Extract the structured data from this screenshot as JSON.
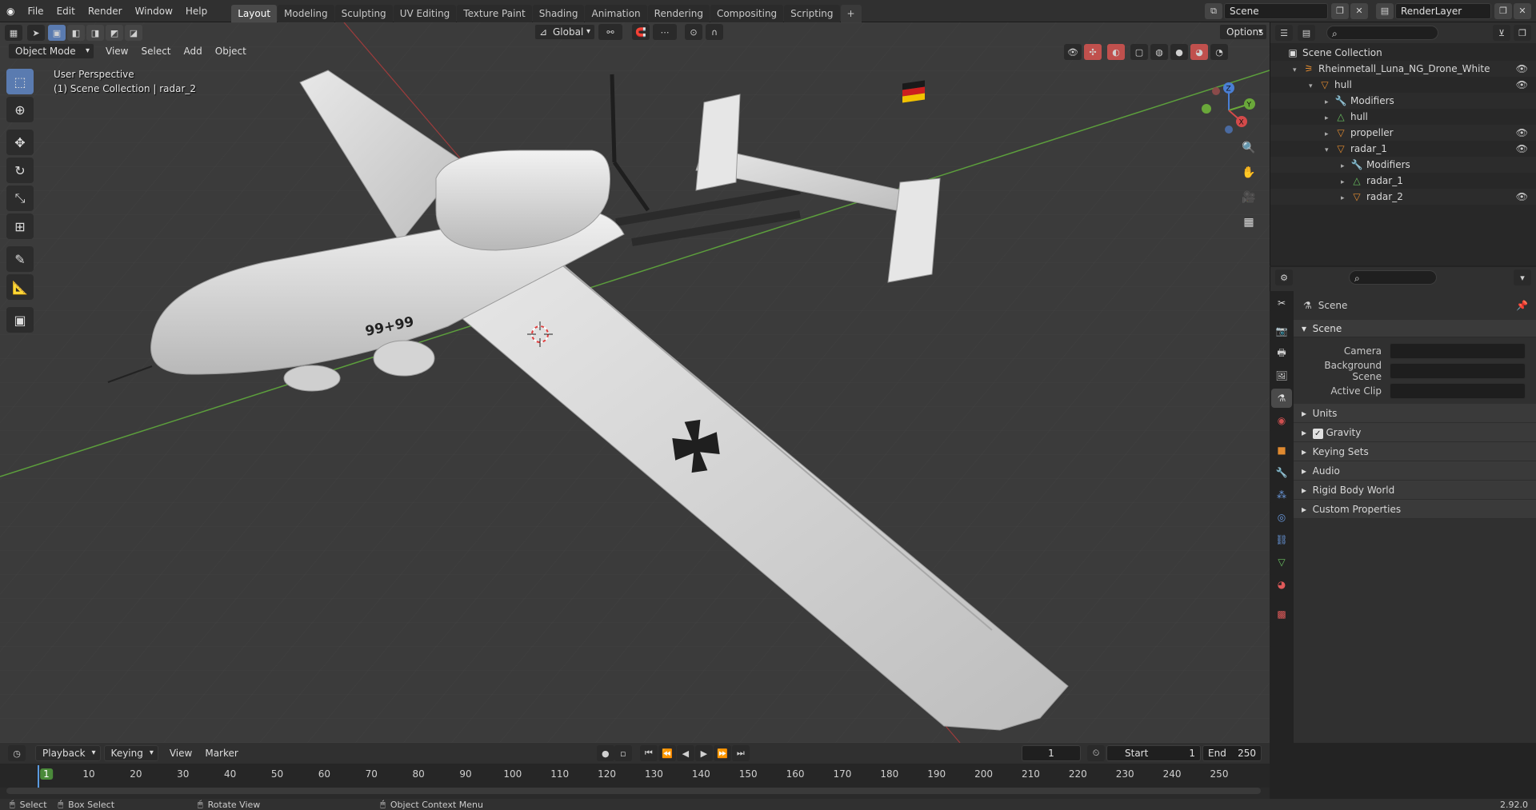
{
  "app": {
    "menus": [
      "File",
      "Edit",
      "Render",
      "Window",
      "Help"
    ],
    "workspaces": [
      "Layout",
      "Modeling",
      "Sculpting",
      "UV Editing",
      "Texture Paint",
      "Shading",
      "Animation",
      "Rendering",
      "Compositing",
      "Scripting"
    ],
    "active_workspace": "Layout",
    "scene_name": "Scene",
    "view_layer": "RenderLayer"
  },
  "viewport": {
    "mode": "Object Mode",
    "menus": [
      "View",
      "Select",
      "Add",
      "Object"
    ],
    "transform_orientation": "Global",
    "options_label": "Options",
    "perspective_label": "User Perspective",
    "collection_label": "(1) Scene Collection | radar_2",
    "gizmo": {
      "x": "X",
      "y": "Y",
      "z": "Z"
    },
    "fuselage_text": "99+99"
  },
  "outliner": {
    "rows": [
      {
        "label": "Scene Collection",
        "depth": 0,
        "icon": "collection-icon",
        "expand": "",
        "eye": false
      },
      {
        "label": "Rheinmetall_Luna_NG_Drone_White",
        "depth": 1,
        "icon": "armature-icon",
        "expand": "▾",
        "eye": true
      },
      {
        "label": "hull",
        "depth": 2,
        "icon": "object-icon",
        "expand": "▾",
        "eye": true
      },
      {
        "label": "Modifiers",
        "depth": 3,
        "icon": "wrench-icon",
        "expand": "▸",
        "eye": false
      },
      {
        "label": "hull",
        "depth": 3,
        "icon": "mesh-icon",
        "expand": "▸",
        "eye": false
      },
      {
        "label": "propeller",
        "depth": 3,
        "icon": "object-icon",
        "expand": "▸",
        "eye": true
      },
      {
        "label": "radar_1",
        "depth": 3,
        "icon": "object-icon",
        "expand": "▾",
        "eye": true
      },
      {
        "label": "Modifiers",
        "depth": 4,
        "icon": "wrench-icon",
        "expand": "▸",
        "eye": false
      },
      {
        "label": "radar_1",
        "depth": 4,
        "icon": "mesh-icon",
        "expand": "▸",
        "eye": false
      },
      {
        "label": "radar_2",
        "depth": 4,
        "icon": "object-icon",
        "expand": "▸",
        "eye": true
      }
    ]
  },
  "properties": {
    "breadcrumb": "Scene",
    "panel_title": "Scene",
    "fields": [
      {
        "label": "Camera"
      },
      {
        "label": "Background Scene"
      },
      {
        "label": "Active Clip"
      }
    ],
    "subpanels": [
      "Units",
      "Gravity",
      "Keying Sets",
      "Audio",
      "Rigid Body World",
      "Custom Properties"
    ]
  },
  "timeline": {
    "menus": [
      "Playback",
      "Keying",
      "View",
      "Marker"
    ],
    "current_frame": "1",
    "start_label": "Start",
    "start": "1",
    "end_label": "End",
    "end": "250",
    "ticks": [
      "1",
      "10",
      "20",
      "30",
      "40",
      "50",
      "60",
      "70",
      "80",
      "90",
      "100",
      "110",
      "120",
      "130",
      "140",
      "150",
      "160",
      "170",
      "180",
      "190",
      "200",
      "210",
      "220",
      "230",
      "240",
      "250"
    ]
  },
  "statusbar": {
    "select": "Select",
    "box_select": "Box Select",
    "rotate_view": "Rotate View",
    "context_menu": "Object Context Menu",
    "version": "2.92.0"
  }
}
